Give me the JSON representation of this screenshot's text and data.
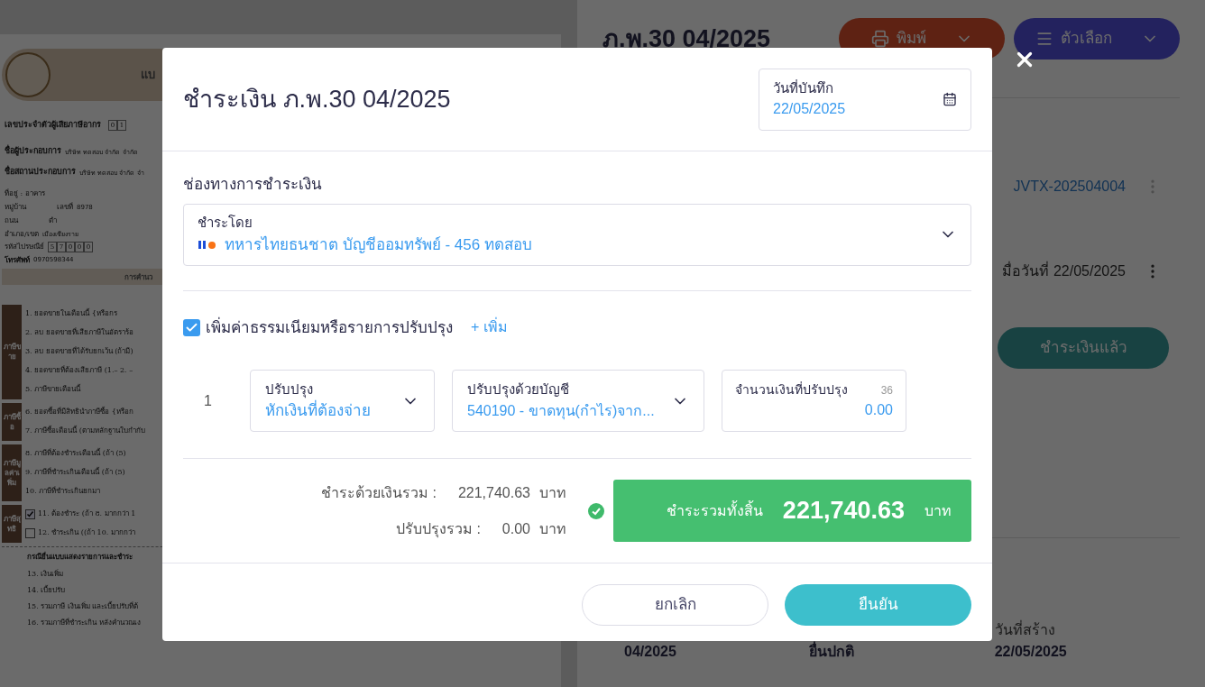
{
  "document": {
    "header_title": "แบ",
    "taxpayer_id_label": "เลขประจำตัวผู้เสียภาษีอากร",
    "taxpayer_id_digits": [
      "0",
      "1"
    ],
    "fields": [
      {
        "label": "ชื่อผู้ประกอบการ",
        "value": "บริษัท ทดสอบ จำกัด จำกัด"
      },
      {
        "label": "ชื่อสถานประกอบการ",
        "value": "บริษัท ทดสอบ จำกัด จำ"
      },
      {
        "label": "ที่อยู่ : อาคาร"
      },
      {
        "label": "หมู่บ้าน",
        "extra_label": "เลขที่",
        "extra_value": "8978"
      },
      {
        "label": "ถนน",
        "extra_label": "ตำ"
      },
      {
        "label": "อำเภอ/เขต",
        "value": "เมืองเชียงราย"
      }
    ],
    "postcode_label": "รหัสไปรษณีย์",
    "postcode_digits": [
      "5",
      "7",
      "0",
      "0",
      "0"
    ],
    "phone_label": "โทรศัพท์",
    "phone_value": "0970598344",
    "section_title": "การคำนว",
    "groups": [
      {
        "label": "ภาษีขาย",
        "rows": [
          {
            "kind": "line",
            "text": "1. ยอดขายในเดือนนี้ {หรือกร"
          },
          {
            "kind": "line",
            "text": "2. ลบ ยอดขายที่เสียภาษีในอัตราร้อ"
          },
          {
            "kind": "line",
            "text": "3. ลบ ยอดขายที่ได้รับยกเว้น (ถ้ามี)"
          },
          {
            "kind": "line",
            "text": "4. ยอดขายที่ต้องเสียภาษี (1.– 2. –"
          },
          {
            "kind": "line",
            "text": "5. ภาษีขายเดือนนี้"
          }
        ]
      },
      {
        "label": "ภาษีซื้อ",
        "rows": [
          {
            "kind": "line",
            "text": "6. ยอดซื้อที่มีสิทธินำภาษีซื้อ {หรือก"
          },
          {
            "kind": "line",
            "text": "7. ภาษีซื้อเดือนนี้ (ตามหลักฐานใบกำกับ"
          }
        ]
      },
      {
        "label": "ภาษีมูลค่าเพิ่ม",
        "rows": [
          {
            "kind": "line",
            "text": "8. ภาษีที่ต้องชำระเดือนนี้ (ถ้า (5)"
          },
          {
            "kind": "line",
            "text": "9. ภาษีที่ชำระเกินเดือนนี้ (ถ้า (5)"
          },
          {
            "kind": "line",
            "text": "10. ภาษีที่ชำระเกินยกมา"
          }
        ]
      },
      {
        "label": "ภาษีสุทธิ",
        "rows": [
          {
            "kind": "check",
            "checked": true,
            "text": "11. ต้องชำระ (ถ้า 8. มากกว่า 1"
          },
          {
            "kind": "check",
            "checked": false,
            "text": "12. ชำระเกิน ((ถ้า 10. มากกว่า"
          }
        ]
      }
    ],
    "late_title": "กรณียื่นแบบแสดงรายการและชำระ",
    "late_rows": [
      "13. เงินเพิ่ม",
      "14. เบี้ยปรับ",
      "15. รวมภาษี เงินเพิ่ม และเบี้ยปรับที่ต้",
      "16. รวมภาษีที่ชำระเกิน หลังคำนวณเง"
    ]
  },
  "page": {
    "title": "ภ.พ.30 04/2025",
    "print_button": "พิมพ์",
    "options_button": "ตัวเลือก",
    "journal_link": "JVTX-202504004",
    "paid_note": "มื่อวันที่ 22/05/2025",
    "status_button": "ชำระเงินแล้ว",
    "info": [
      {
        "value": "04/2025"
      },
      {
        "value": "ยื่นปกติ"
      },
      {
        "label": "วันที่สร้าง",
        "value": "22/05/2025"
      }
    ]
  },
  "dialog": {
    "title": "ชำระเงิน ภ.พ.30 04/2025",
    "date_field": {
      "label": "วันที่บันทึก",
      "value": "22/05/2025"
    },
    "channel_title": "ช่องทางการชำระเงิน",
    "pay_by": {
      "label": "ชำระโดย",
      "value": "ทหารไทยธนชาต บัญชีออมทรัพย์ - 456 ทดสอบ"
    },
    "adjust_checkbox": {
      "label": "เพิ่มค่าธรรมเนียมหรือรายการปรับปรุง",
      "checked": true
    },
    "add_link": "+ เพิ่ม",
    "adjustments": [
      {
        "index": "1",
        "type": {
          "label": "ปรับปรุง",
          "value": "หักเงินที่ต้องจ่าย"
        },
        "account": {
          "label": "ปรับปรุงด้วยบัญชี",
          "value": "540190 - ขาดทุน(กำไร)จาก..."
        },
        "amount": {
          "label": "จำนวนเงินที่ปรับปรุง",
          "counter": "36",
          "value": "0.00"
        }
      }
    ],
    "summary": [
      {
        "label": "ชำระด้วยเงินรวม :",
        "value": "221,740.63",
        "unit": "บาท"
      },
      {
        "label": "ปรับปรุงรวม :",
        "value": "0.00",
        "unit": "บาท"
      }
    ],
    "total": {
      "label": "ชำระรวมทั้งสิ้น",
      "value": "221,740.63",
      "unit": "บาท"
    },
    "cancel_button": "ยกเลิก",
    "confirm_button": "ยืนยัน"
  }
}
